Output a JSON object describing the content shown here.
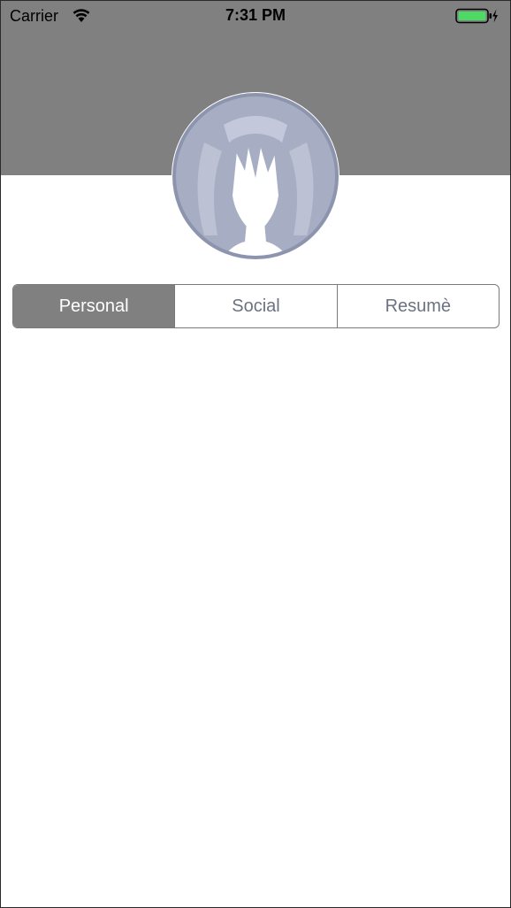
{
  "status_bar": {
    "carrier": "Carrier",
    "time": "7:31 PM",
    "wifi_icon": "wifi-icon",
    "battery_icon": "battery-icon",
    "charging_icon": "charging-bolt-icon",
    "battery_color": "#4cd964"
  },
  "header": {
    "background_color": "#808080",
    "avatar_icon": "profile-avatar-icon"
  },
  "segments": {
    "items": [
      {
        "label": "Personal",
        "selected": true
      },
      {
        "label": "Social",
        "selected": false
      },
      {
        "label": "Resumè",
        "selected": false
      }
    ],
    "selected_color": "#808080",
    "text_color": "#6b7280"
  }
}
